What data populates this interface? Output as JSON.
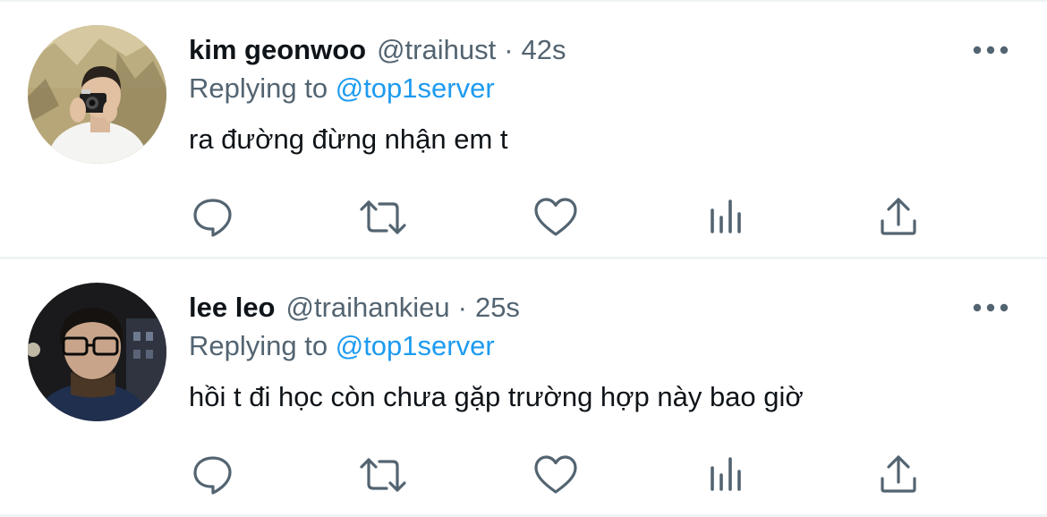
{
  "tweets": [
    {
      "name": "kim geonwoo",
      "handle": "@traihust",
      "separator": "·",
      "time": "42s",
      "replying_prefix": "Replying to",
      "replying_to": "@top1server",
      "text": "ra đường đừng nhận em t"
    },
    {
      "name": "lee leo",
      "handle": "@traihankieu",
      "separator": "·",
      "time": "25s",
      "replying_prefix": "Replying to",
      "replying_to": "@top1server",
      "text": "hồi t đi học còn chưa gặp trường hợp này bao giờ"
    }
  ],
  "icons": {
    "actions": [
      "reply-icon",
      "retweet-icon",
      "like-icon",
      "views-icon",
      "share-icon"
    ],
    "more": "more-icon"
  },
  "colors": {
    "text_primary": "#0f1419",
    "text_secondary": "#536471",
    "accent": "#1d9bf0",
    "divider": "#eff3f4"
  }
}
